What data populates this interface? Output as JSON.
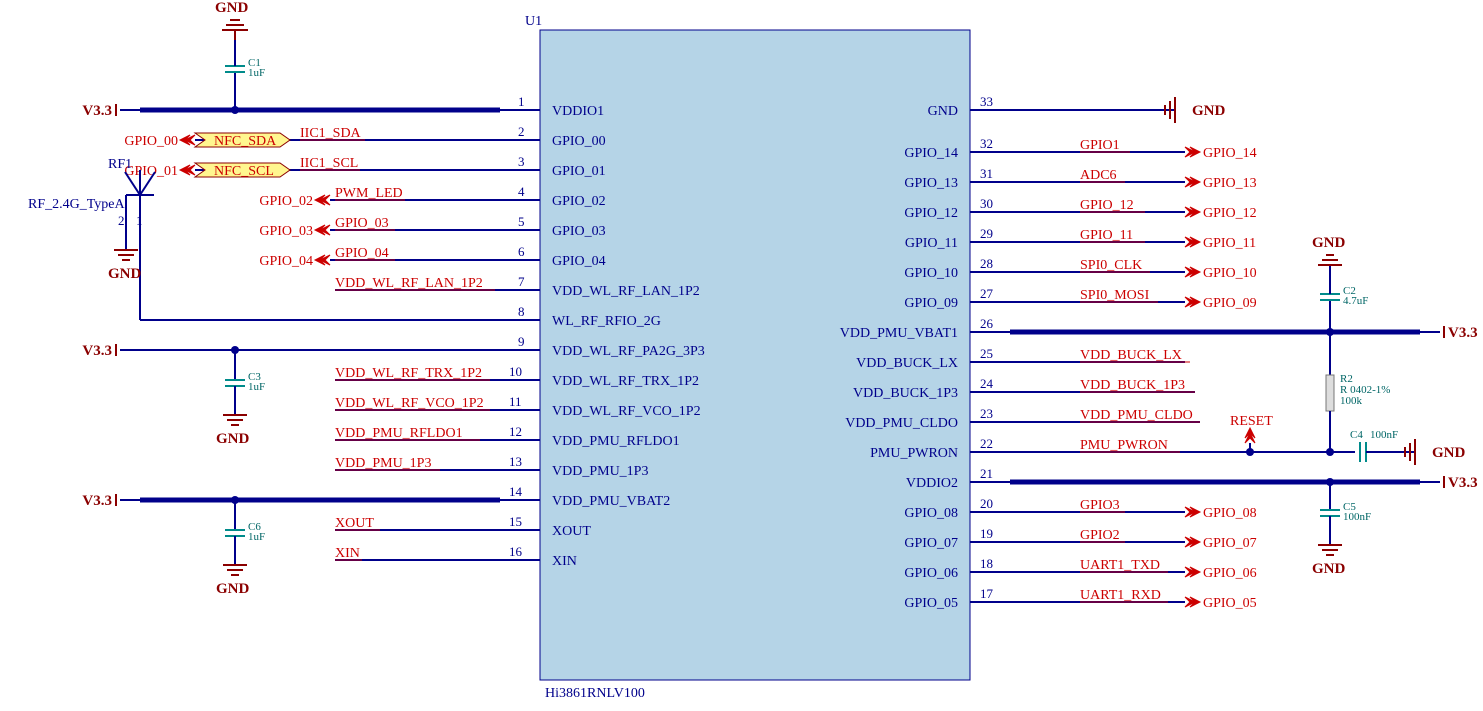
{
  "ic": {
    "ref": "U1",
    "part": "Hi3861RNLV100"
  },
  "left": [
    {
      "n": "1",
      "name": "VDDIO1"
    },
    {
      "n": "2",
      "name": "GPIO_00"
    },
    {
      "n": "3",
      "name": "GPIO_01"
    },
    {
      "n": "4",
      "name": "GPIO_02"
    },
    {
      "n": "5",
      "name": "GPIO_03"
    },
    {
      "n": "6",
      "name": "GPIO_04"
    },
    {
      "n": "7",
      "name": "VDD_WL_RF_LAN_1P2"
    },
    {
      "n": "8",
      "name": "WL_RF_RFIO_2G"
    },
    {
      "n": "9",
      "name": "VDD_WL_RF_PA2G_3P3"
    },
    {
      "n": "10",
      "name": "VDD_WL_RF_TRX_1P2"
    },
    {
      "n": "11",
      "name": "VDD_WL_RF_VCO_1P2"
    },
    {
      "n": "12",
      "name": "VDD_PMU_RFLDO1"
    },
    {
      "n": "13",
      "name": "VDD_PMU_1P3"
    },
    {
      "n": "14",
      "name": "VDD_PMU_VBAT2"
    },
    {
      "n": "15",
      "name": "XOUT"
    },
    {
      "n": "16",
      "name": "XIN"
    }
  ],
  "right": [
    {
      "n": "33",
      "name": "GND"
    },
    {
      "n": "32",
      "name": "GPIO_14"
    },
    {
      "n": "31",
      "name": "GPIO_13"
    },
    {
      "n": "30",
      "name": "GPIO_12"
    },
    {
      "n": "29",
      "name": "GPIO_11"
    },
    {
      "n": "28",
      "name": "GPIO_10"
    },
    {
      "n": "27",
      "name": "GPIO_09"
    },
    {
      "n": "26",
      "name": "VDD_PMU_VBAT1"
    },
    {
      "n": "25",
      "name": "VDD_BUCK_LX"
    },
    {
      "n": "24",
      "name": "VDD_BUCK_1P3"
    },
    {
      "n": "23",
      "name": "VDD_PMU_CLDO"
    },
    {
      "n": "22",
      "name": "PMU_PWRON"
    },
    {
      "n": "21",
      "name": "VDDIO2"
    },
    {
      "n": "20",
      "name": "GPIO_08"
    },
    {
      "n": "19",
      "name": "GPIO_07"
    },
    {
      "n": "18",
      "name": "GPIO_06"
    },
    {
      "n": "17",
      "name": "GPIO_05"
    }
  ],
  "lnet": {
    "p2": {
      "port": "GPIO_00",
      "tag": "NFC_SDA",
      "lbl": "IIC1_SDA"
    },
    "p3": {
      "port": "GPIO_01",
      "tag": "NFC_SCL",
      "lbl": "IIC1_SCL"
    },
    "p4": {
      "port": "GPIO_02",
      "lbl": "PWM_LED"
    },
    "p5": {
      "port": "GPIO_03",
      "lbl": "GPIO_03"
    },
    "p6": {
      "port": "GPIO_04",
      "lbl": "GPIO_04"
    },
    "p7": {
      "lbl": "VDD_WL_RF_LAN_1P2"
    },
    "p10": {
      "lbl": "VDD_WL_RF_TRX_1P2"
    },
    "p11": {
      "lbl": "VDD_WL_RF_VCO_1P2"
    },
    "p12": {
      "lbl": "VDD_PMU_RFLDO1"
    },
    "p13": {
      "lbl": "VDD_PMU_1P3"
    },
    "p15": {
      "lbl": "XOUT"
    },
    "p16": {
      "lbl": "XIN"
    }
  },
  "rnet": {
    "p32": {
      "lbl": "GPIO1",
      "port": "GPIO_14"
    },
    "p31": {
      "lbl": "ADC6",
      "port": "GPIO_13"
    },
    "p30": {
      "lbl": "GPIO_12",
      "port": "GPIO_12"
    },
    "p29": {
      "lbl": "GPIO_11",
      "port": "GPIO_11"
    },
    "p28": {
      "lbl": "SPI0_CLK",
      "port": "GPIO_10"
    },
    "p27": {
      "lbl": "SPI0_MOSI",
      "port": "GPIO_09"
    },
    "p25": {
      "lbl": "VDD_BUCK_LX"
    },
    "p24": {
      "lbl": "VDD_BUCK_1P3"
    },
    "p23": {
      "lbl": "VDD_PMU_CLDO"
    },
    "p22": {
      "lbl": "PMU_PWRON",
      "reset": "RESET"
    },
    "p20": {
      "lbl": "GPIO3",
      "port": "GPIO_08"
    },
    "p19": {
      "lbl": "GPIO2",
      "port": "GPIO_07"
    },
    "p18": {
      "lbl": "UART1_TXD",
      "port": "GPIO_06"
    },
    "p17": {
      "lbl": "UART1_RXD",
      "port": "GPIO_05"
    }
  },
  "pwr": {
    "v33": "V3.3",
    "gnd": "GND"
  },
  "rf": {
    "ref": "RF1",
    "type": "RF_2.4G_TypeA",
    "p1": "1",
    "p2": "2"
  },
  "c": {
    "c1": {
      "ref": "C1",
      "val": "1uF"
    },
    "c2": {
      "ref": "C2",
      "val": "4.7uF"
    },
    "c3": {
      "ref": "C3",
      "val": "1uF"
    },
    "c4": {
      "ref": "C4",
      "val": "100nF"
    },
    "c5": {
      "ref": "C5",
      "val": "100nF"
    },
    "c6": {
      "ref": "C6",
      "val": "1uF"
    }
  },
  "r": {
    "r2": {
      "ref": "R2",
      "val": "R 0402-1%",
      "val2": "100k"
    }
  }
}
